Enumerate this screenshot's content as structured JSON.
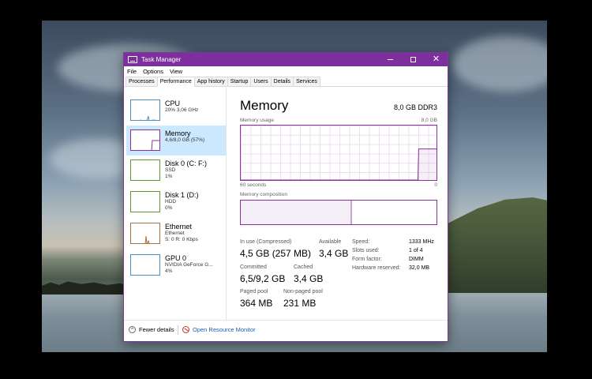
{
  "window": {
    "title": "Task Manager"
  },
  "menu": [
    "File",
    "Options",
    "View"
  ],
  "tabs": [
    "Processes",
    "Performance",
    "App history",
    "Startup",
    "Users",
    "Details",
    "Services"
  ],
  "sidebar": {
    "items": [
      {
        "name": "CPU",
        "line1": "20% 3,06 GHz",
        "line2": ""
      },
      {
        "name": "Memory",
        "line1": "4,6/8,0 GB (57%)",
        "line2": ""
      },
      {
        "name": "Disk 0 (C: F:)",
        "line1": "SSD",
        "line2": "1%"
      },
      {
        "name": "Disk 1 (D:)",
        "line1": "HDD",
        "line2": "0%"
      },
      {
        "name": "Ethernet",
        "line1": "Ethernet",
        "line2": "S: 0  R: 0 Kbps"
      },
      {
        "name": "GPU 0",
        "line1": "NVIDIA GeForce G...",
        "line2": "4%"
      }
    ]
  },
  "memory": {
    "title": "Memory",
    "capacity": "8,0 GB DDR3",
    "usage_label": "Memory usage",
    "usage_max": "8,0 GB",
    "time_left": "60 seconds",
    "time_right": "0",
    "composition_label": "Memory composition",
    "composition_in_use_fraction": 0.57,
    "usage_history_fraction": [
      0,
      0,
      0,
      0,
      0,
      0,
      0,
      0,
      0,
      0,
      0,
      0,
      0,
      0,
      0,
      0,
      0,
      0,
      0,
      0,
      0.57,
      0.57,
      0.57
    ],
    "stats": {
      "in_use_label": "In use (Compressed)",
      "in_use_value": "4,5 GB (257 MB)",
      "available_label": "Available",
      "available_value": "3,4 GB",
      "committed_label": "Committed",
      "committed_value": "6,5/9,2 GB",
      "cached_label": "Cached",
      "cached_value": "3,4 GB",
      "paged_label": "Paged pool",
      "paged_value": "364 MB",
      "nonpaged_label": "Non-paged pool",
      "nonpaged_value": "231 MB"
    },
    "specs": {
      "speed_label": "Speed:",
      "speed_value": "1333 MHz",
      "slots_label": "Slots used:",
      "slots_value": "1 of 4",
      "form_label": "Form factor:",
      "form_value": "DIMM",
      "reserved_label": "Hardware reserved:",
      "reserved_value": "32,0 MB"
    }
  },
  "footer": {
    "fewer_details": "Fewer details",
    "resource_monitor": "Open Resource Monitor"
  },
  "colors": {
    "accent": "#7d2f9e",
    "memory_line": "#8b2f9e",
    "selected": "#cce8ff",
    "link": "#1a62b0"
  }
}
